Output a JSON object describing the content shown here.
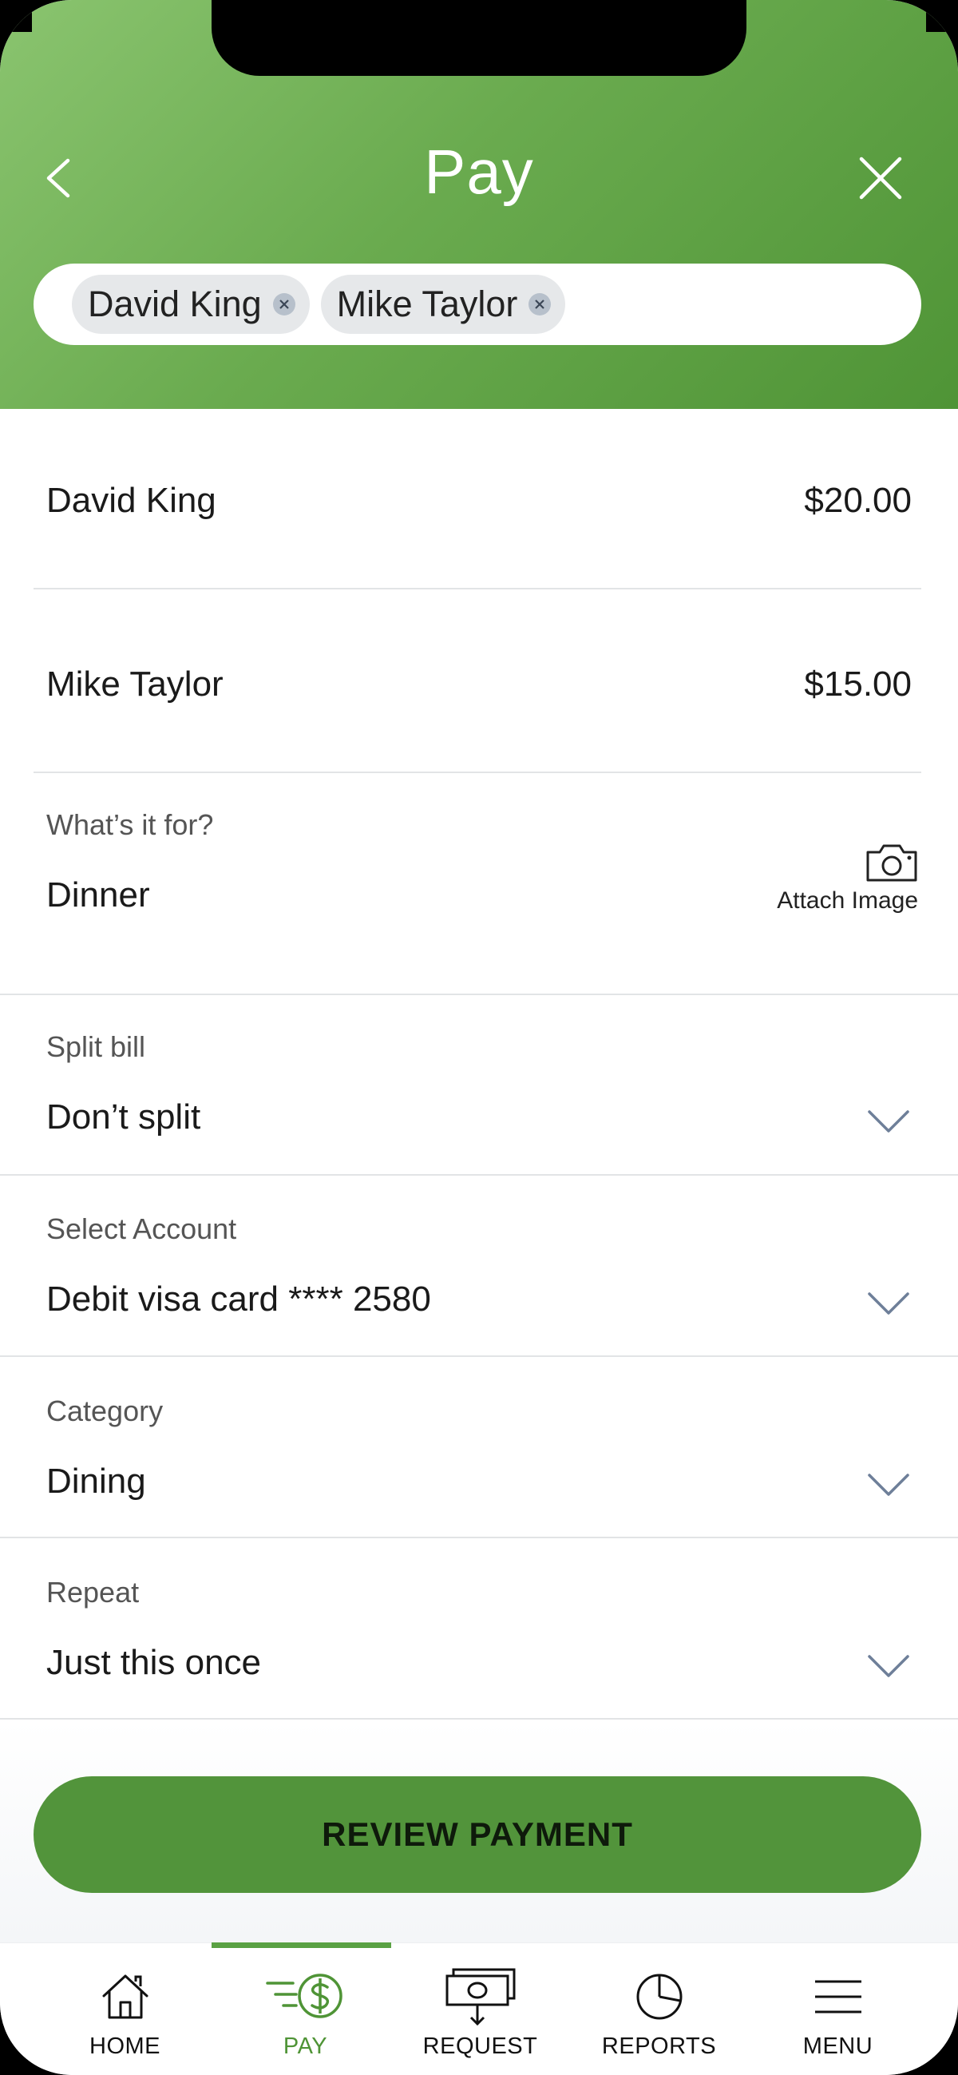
{
  "header": {
    "title": "Pay",
    "recipients": [
      "David King",
      "Mike Taylor"
    ]
  },
  "payees": [
    {
      "name": "David King",
      "amount": "$20.00"
    },
    {
      "name": "Mike Taylor",
      "amount": "$15.00"
    }
  ],
  "purpose": {
    "label": "What’s it for?",
    "value": "Dinner",
    "attach_label": "Attach Image"
  },
  "fields": [
    {
      "label": "Split bill",
      "value": "Don’t split"
    },
    {
      "label": "Select Account",
      "value": "Debit visa card **** 2580"
    },
    {
      "label": "Category",
      "value": "Dining"
    },
    {
      "label": "Repeat",
      "value": "Just this once"
    }
  ],
  "review_button": "REVIEW PAYMENT",
  "tabs": [
    {
      "label": "HOME",
      "icon": "home-icon"
    },
    {
      "label": "PAY",
      "icon": "pay-icon",
      "active": true
    },
    {
      "label": "REQUEST",
      "icon": "request-icon"
    },
    {
      "label": "REPORTS",
      "icon": "reports-icon"
    },
    {
      "label": "MENU",
      "icon": "menu-icon"
    }
  ],
  "colors": {
    "brand_green": "#52943b",
    "header_gradient_start": "#8ac46f",
    "header_gradient_end": "#4f9436",
    "chevron": "#6e7f99"
  }
}
